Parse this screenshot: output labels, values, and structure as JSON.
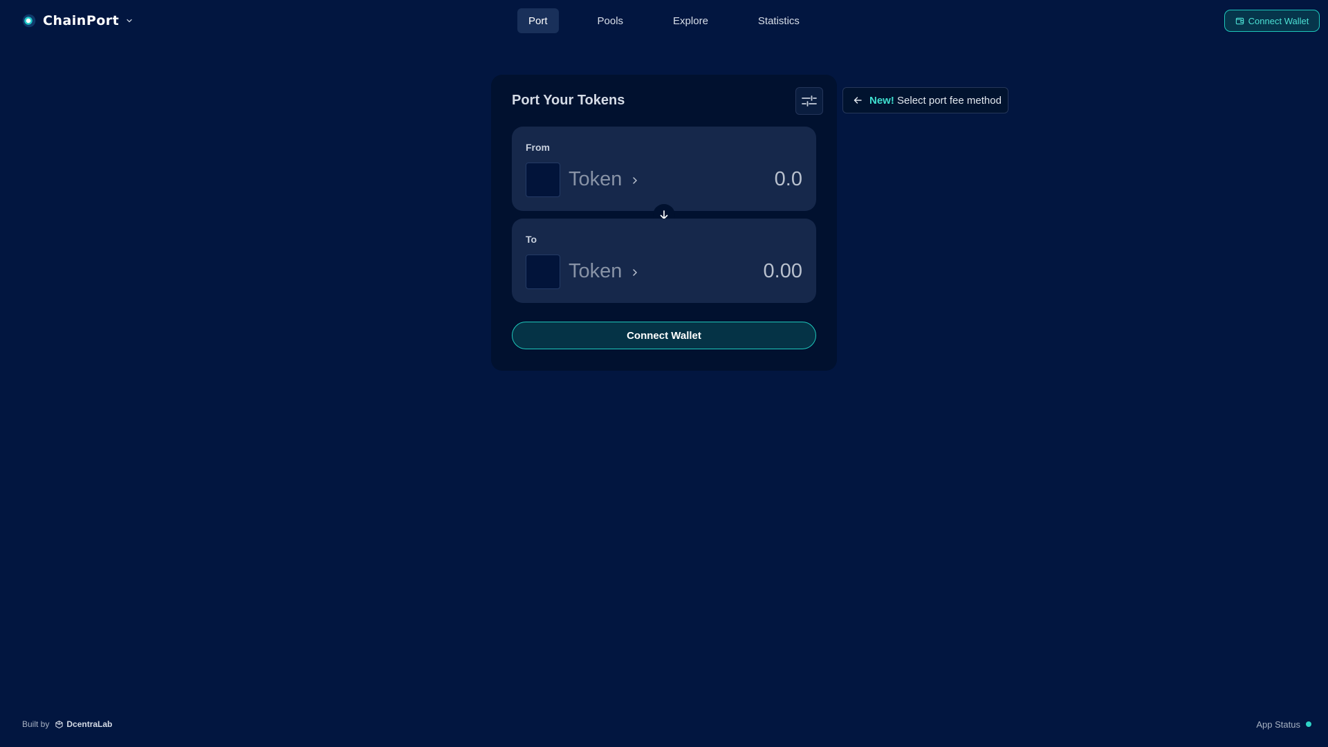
{
  "header": {
    "app_name": "ChainPort",
    "app_menu_icon": "chevron-down-icon",
    "nav": [
      {
        "label": "Port",
        "active": true
      },
      {
        "label": "Pools",
        "active": false
      },
      {
        "label": "Explore",
        "active": false
      },
      {
        "label": "Statistics",
        "active": false
      }
    ],
    "connect_wallet_label": "Connect Wallet",
    "wallet_icon": "wallet-icon"
  },
  "port_card": {
    "title": "Port Your Tokens",
    "settings_icon": "sliders-icon",
    "from": {
      "label": "From",
      "token_placeholder": "Token",
      "amount": "0.0"
    },
    "swap_icon": "arrow-down-icon",
    "to": {
      "label": "To",
      "token_placeholder": "Token",
      "amount": "0.00"
    },
    "connect_wallet_label": "Connect Wallet"
  },
  "hint": {
    "icon": "arrow-left-icon",
    "badge": "New!",
    "text": "Select port fee method"
  },
  "footer": {
    "built_by": "Built by",
    "brand": "DcentraLab",
    "status_label": "App Status",
    "status_color": "#2ed3c6"
  },
  "colors": {
    "background": "#021640",
    "card": "#01112f",
    "panel": "#16284b",
    "accent": "#1ec9bd"
  }
}
